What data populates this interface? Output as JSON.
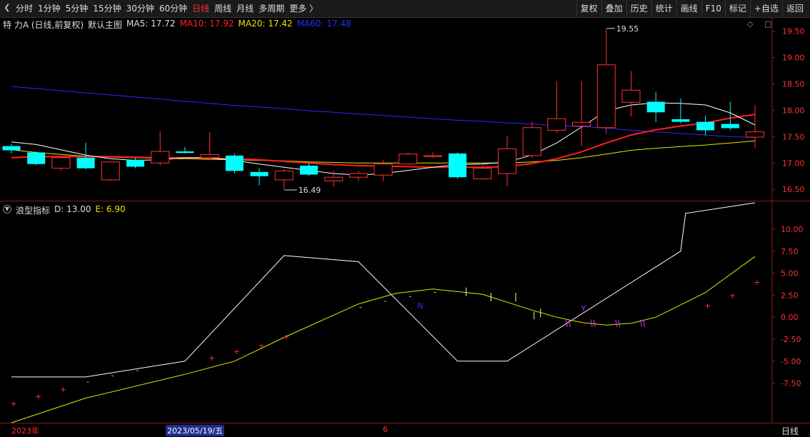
{
  "toolbar": {
    "left_items": [
      {
        "label": "分时",
        "active": false
      },
      {
        "label": "1分钟",
        "active": false
      },
      {
        "label": "5分钟",
        "active": false
      },
      {
        "label": "15分钟",
        "active": false
      },
      {
        "label": "30分钟",
        "active": false
      },
      {
        "label": "60分钟",
        "active": false
      },
      {
        "label": "日线",
        "active": true
      },
      {
        "label": "周线",
        "active": false
      },
      {
        "label": "月线",
        "active": false
      },
      {
        "label": "多周期",
        "active": false
      },
      {
        "label": "更多 〉",
        "active": false
      }
    ],
    "right_items": [
      "复权",
      "叠加",
      "历史",
      "统计",
      "画线",
      "F10",
      "标记",
      "+自选",
      "返回"
    ]
  },
  "main_info": {
    "stock_name": "特 力A (日线,前复权)",
    "template": "默认主图",
    "ma5": "MA5: 17.72",
    "ma10": "MA10: 17.92",
    "ma20": "MA20: 17.42",
    "ma60": "MA60: 17.48"
  },
  "indicator_info": {
    "name": "浪型指标",
    "d": "D: 13.00",
    "e": "E: 6.90"
  },
  "annotations": {
    "high": "19.55",
    "low": "16.49"
  },
  "axis": {
    "price_ticks": [
      "19.50",
      "19.00",
      "18.50",
      "18.00",
      "17.50",
      "17.00",
      "16.50"
    ],
    "ind_ticks": [
      "10.00",
      "7.50",
      "5.00",
      "2.50",
      "0.00",
      "-2.50",
      "-5.00",
      "-7.50"
    ]
  },
  "dates": {
    "start": "2023年",
    "cursor": "2023/05/19/五",
    "month": "6"
  },
  "period": "日线",
  "colors": {
    "up": "#ff3232",
    "down": "#00ffff",
    "ma5": "#ffffff",
    "ma10": "#ff2020",
    "ma20": "#e6e600",
    "ma60": "#2b2bff",
    "axis_red": "#8b1a1a"
  },
  "chart_data": {
    "type": "candlestick",
    "price_range": [
      16.3,
      19.75
    ],
    "indicator_range": [
      -12,
      13
    ],
    "candles": [
      {
        "o": 17.32,
        "h": 17.36,
        "l": 17.18,
        "c": 17.24
      },
      {
        "o": 17.2,
        "h": 17.22,
        "l": 16.96,
        "c": 16.98
      },
      {
        "o": 16.9,
        "h": 17.12,
        "l": 16.85,
        "c": 17.1
      },
      {
        "o": 17.1,
        "h": 17.38,
        "l": 16.88,
        "c": 16.9
      },
      {
        "o": 16.68,
        "h": 17.03,
        "l": 16.66,
        "c": 17.02
      },
      {
        "o": 17.06,
        "h": 17.1,
        "l": 16.9,
        "c": 16.93
      },
      {
        "o": 17.0,
        "h": 17.6,
        "l": 16.95,
        "c": 17.22
      },
      {
        "o": 17.22,
        "h": 17.3,
        "l": 17.18,
        "c": 17.19
      },
      {
        "o": 17.1,
        "h": 17.58,
        "l": 17.05,
        "c": 17.16
      },
      {
        "o": 17.14,
        "h": 17.18,
        "l": 16.8,
        "c": 16.85
      },
      {
        "o": 16.83,
        "h": 16.9,
        "l": 16.58,
        "c": 16.75
      },
      {
        "o": 16.68,
        "h": 16.88,
        "l": 16.49,
        "c": 16.85
      },
      {
        "o": 16.95,
        "h": 17.0,
        "l": 16.75,
        "c": 16.78
      },
      {
        "o": 16.66,
        "h": 16.86,
        "l": 16.55,
        "c": 16.73
      },
      {
        "o": 16.73,
        "h": 16.85,
        "l": 16.66,
        "c": 16.8
      },
      {
        "o": 16.77,
        "h": 17.05,
        "l": 16.66,
        "c": 16.98
      },
      {
        "o": 16.98,
        "h": 17.2,
        "l": 16.96,
        "c": 17.17
      },
      {
        "o": 17.13,
        "h": 17.2,
        "l": 17.1,
        "c": 17.14
      },
      {
        "o": 17.18,
        "h": 17.2,
        "l": 16.7,
        "c": 16.73
      },
      {
        "o": 16.7,
        "h": 16.95,
        "l": 16.68,
        "c": 16.9
      },
      {
        "o": 16.8,
        "h": 17.52,
        "l": 16.55,
        "c": 17.27
      },
      {
        "o": 17.14,
        "h": 17.78,
        "l": 17.1,
        "c": 17.67
      },
      {
        "o": 17.62,
        "h": 18.55,
        "l": 17.57,
        "c": 17.84
      },
      {
        "o": 17.7,
        "h": 18.55,
        "l": 17.32,
        "c": 17.77
      },
      {
        "o": 17.67,
        "h": 19.55,
        "l": 17.55,
        "c": 18.86
      },
      {
        "o": 18.15,
        "h": 18.74,
        "l": 17.88,
        "c": 18.38
      },
      {
        "o": 18.16,
        "h": 18.35,
        "l": 17.78,
        "c": 17.96
      },
      {
        "o": 17.83,
        "h": 18.22,
        "l": 17.75,
        "c": 17.78
      },
      {
        "o": 17.78,
        "h": 17.9,
        "l": 17.52,
        "c": 17.62
      },
      {
        "o": 17.74,
        "h": 18.16,
        "l": 17.62,
        "c": 17.66
      },
      {
        "o": 17.49,
        "h": 18.1,
        "l": 17.28,
        "c": 17.59
      }
    ],
    "ma5": [
      17.4,
      17.35,
      17.25,
      17.15,
      17.08,
      17.05,
      17.06,
      17.1,
      17.1,
      17.05,
      16.98,
      16.92,
      16.86,
      16.8,
      16.77,
      16.8,
      16.86,
      16.92,
      16.97,
      16.98,
      17.02,
      17.15,
      17.38,
      17.68,
      17.99,
      18.1,
      18.14,
      18.13,
      18.1,
      17.95,
      17.72
    ],
    "ma10": [
      17.1,
      17.12,
      17.12,
      17.12,
      17.12,
      17.11,
      17.1,
      17.1,
      17.09,
      17.08,
      17.06,
      17.03,
      17.0,
      16.97,
      16.95,
      16.94,
      16.93,
      16.92,
      16.92,
      16.92,
      16.93,
      16.99,
      17.08,
      17.21,
      17.38,
      17.53,
      17.63,
      17.7,
      17.76,
      17.85,
      17.92
    ],
    "ma20": [
      17.25,
      17.2,
      17.16,
      17.13,
      17.11,
      17.1,
      17.09,
      17.08,
      17.07,
      17.06,
      17.05,
      17.04,
      17.02,
      17.01,
      17.0,
      17.0,
      17.0,
      17.0,
      17.0,
      17.0,
      17.0,
      17.02,
      17.05,
      17.1,
      17.17,
      17.24,
      17.28,
      17.31,
      17.34,
      17.38,
      17.42
    ],
    "ma60": [
      18.45,
      18.41,
      18.37,
      18.33,
      18.29,
      18.25,
      18.21,
      18.17,
      18.13,
      18.09,
      18.06,
      18.03,
      17.99,
      17.96,
      17.93,
      17.9,
      17.87,
      17.84,
      17.81,
      17.79,
      17.76,
      17.74,
      17.71,
      17.69,
      17.66,
      17.62,
      17.59,
      17.56,
      17.53,
      17.5,
      17.48
    ],
    "d_line": [
      [
        0,
        -6.8
      ],
      [
        3,
        -6.8
      ],
      [
        7,
        -5.0
      ],
      [
        11,
        7.0
      ],
      [
        14,
        6.3
      ],
      [
        18,
        -5.0
      ],
      [
        20,
        -5.0
      ],
      [
        27,
        7.5
      ],
      [
        27.2,
        11.8
      ],
      [
        30,
        13.0
      ]
    ],
    "e_line": [
      [
        0,
        -12
      ],
      [
        3,
        -9.2
      ],
      [
        7,
        -6.5
      ],
      [
        9,
        -5.0
      ],
      [
        11,
        -2.3
      ],
      [
        14,
        1.5
      ],
      [
        15.5,
        2.7
      ],
      [
        17,
        3.2
      ],
      [
        19,
        2.6
      ],
      [
        21,
        0.8
      ],
      [
        22,
        0.0
      ],
      [
        23,
        -0.6
      ],
      [
        24,
        -0.9
      ],
      [
        25,
        -0.7
      ],
      [
        26,
        0.0
      ],
      [
        28,
        2.8
      ],
      [
        30,
        6.9
      ]
    ],
    "markers": [
      {
        "i": 0,
        "t": "+",
        "v": -9.8,
        "c": "#ff3232"
      },
      {
        "i": 1,
        "t": "+",
        "v": -9.0,
        "c": "#ff3232"
      },
      {
        "i": 2,
        "t": "+",
        "v": -8.2,
        "c": "#ff3232"
      },
      {
        "i": 3,
        "t": "-",
        "v": -7.3,
        "c": "#e6e600"
      },
      {
        "i": 4,
        "t": "-",
        "v": -6.6,
        "c": "#e6e600"
      },
      {
        "i": 5,
        "t": "-",
        "v": -6.0,
        "c": "#e6e600"
      },
      {
        "i": 8,
        "t": "+",
        "v": -4.6,
        "c": "#ff3232"
      },
      {
        "i": 9,
        "t": "+",
        "v": -3.9,
        "c": "#ff3232"
      },
      {
        "i": 10,
        "t": "+",
        "v": -3.2,
        "c": "#ff3232"
      },
      {
        "i": 11,
        "t": "+",
        "v": -2.2,
        "c": "#ff3232"
      },
      {
        "i": 14,
        "t": "-",
        "v": 1.2,
        "c": "#e6e600"
      },
      {
        "i": 15,
        "t": "-",
        "v": 1.9,
        "c": "#e6e600"
      },
      {
        "i": 16,
        "t": "-",
        "v": 2.4,
        "c": "#e6e600"
      },
      {
        "i": 17,
        "t": "-",
        "v": 2.9,
        "c": "#e6e600"
      },
      {
        "i": 21,
        "t": "|",
        "v": 0.3,
        "c": "#ffff80"
      },
      {
        "i": 23,
        "t": "Y",
        "v": 1.0,
        "c": "#b030ff"
      },
      {
        "i": 28,
        "t": "+",
        "v": 1.3,
        "c": "#ff3232"
      },
      {
        "i": 29,
        "t": "+",
        "v": 2.5,
        "c": "#ff3232"
      },
      {
        "i": 30,
        "t": "+",
        "v": 4.0,
        "c": "#ff3232"
      }
    ],
    "n_marker": {
      "i": 16.5,
      "v": 1.3,
      "label": "N",
      "c": "#2b2bff"
    },
    "wave_markers": [
      22,
      23,
      24,
      25
    ],
    "ticks_white": [
      18,
      19,
      20,
      21
    ]
  }
}
